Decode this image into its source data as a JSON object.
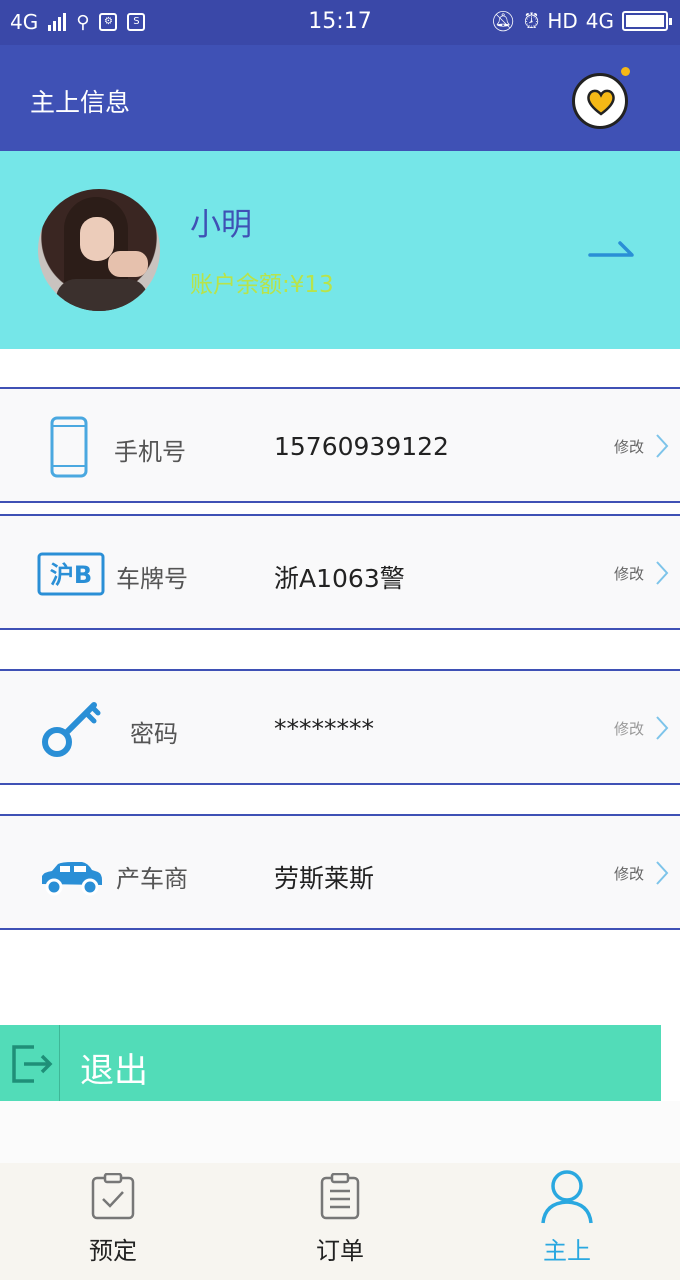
{
  "status_bar": {
    "network": "4G",
    "time": "15:17",
    "hd": "HD",
    "network_right": "4G"
  },
  "app_bar": {
    "title": "主上信息"
  },
  "profile": {
    "name": "小明",
    "balance": "账户余额:¥13"
  },
  "info_rows": [
    {
      "label": "手机号",
      "value": "15760939122",
      "edit": "修改"
    },
    {
      "label": "车牌号",
      "value": "浙A1063警",
      "edit": "修改"
    },
    {
      "label": "密码",
      "value": "********",
      "edit": "修改"
    },
    {
      "label": "产车商",
      "value": "劳斯莱斯",
      "edit": "修改"
    }
  ],
  "logout": {
    "label": "退出"
  },
  "tab_bar": {
    "tabs": [
      {
        "label": "预定"
      },
      {
        "label": "订单"
      },
      {
        "label": "主上"
      }
    ]
  },
  "colors": {
    "status_bar": "#3a48a8",
    "app_bar": "#3f51b5",
    "profile_bg": "#75e6e8",
    "balance_text": "#b8e34a",
    "logout_bg": "#52dcb8",
    "active_tab": "#2aa8e0",
    "row_border": "#3f51b5"
  }
}
